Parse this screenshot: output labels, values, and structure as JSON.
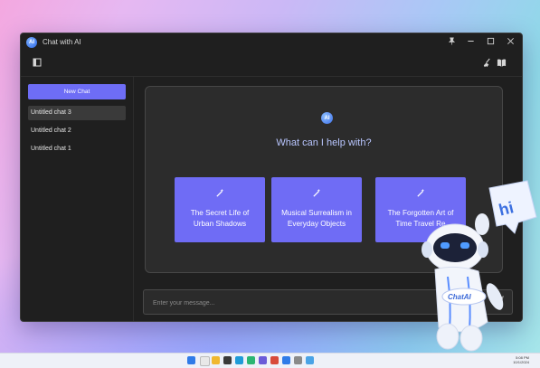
{
  "window": {
    "title": "Chat with AI",
    "logo_text": "AI",
    "controls": [
      "pin-icon",
      "minimize-icon",
      "maximize-icon",
      "close-icon"
    ]
  },
  "toolbar": {
    "left_icon": "sidebar-toggle-icon",
    "right_icons": [
      "broom-icon",
      "book-icon"
    ]
  },
  "sidebar": {
    "new_chat_label": "New Chat",
    "chats": [
      {
        "label": "Untitled chat 3",
        "active": true
      },
      {
        "label": "Untitled chat 2",
        "active": false
      },
      {
        "label": "Untitled chat 1",
        "active": false
      }
    ]
  },
  "main": {
    "logo_text": "AI",
    "headline": "What can I help with?",
    "suggestions": [
      {
        "text": "The Secret Life of Urban Shadows",
        "icon": "magic-wand-icon"
      },
      {
        "text": "Musical Surrealism in Everyday Objects",
        "icon": "magic-wand-icon"
      },
      {
        "text": "The Forgotten Art of Time Travel Re",
        "icon": "magic-wand-icon"
      }
    ]
  },
  "input": {
    "placeholder": "Enter your message...",
    "value": ""
  },
  "mascot": {
    "badge_text": "ChatAI",
    "bubble_text": "hi"
  },
  "taskbar": {
    "time": "5:08 PM",
    "date": "10/1/2024"
  },
  "colors": {
    "accent": "#6f6cf5",
    "headline": "#b9c6ff",
    "window_bg": "#1f1f1f",
    "panel_bg": "#2c2c2c"
  }
}
